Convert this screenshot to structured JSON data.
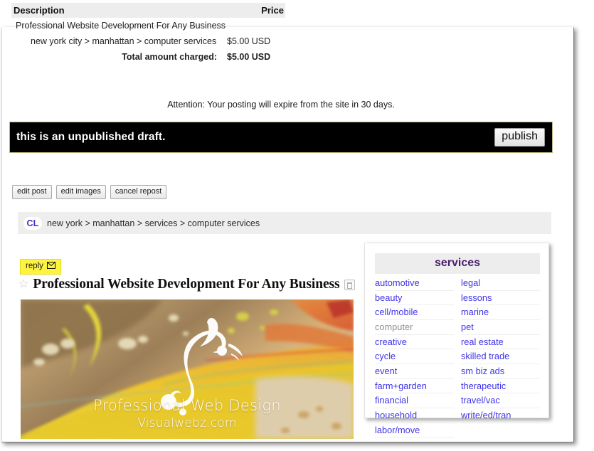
{
  "receipt": {
    "header": {
      "description_label": "Description",
      "price_label": "Price"
    },
    "rows": [
      {
        "description": "Professional Website Development For Any Business",
        "price": ""
      },
      {
        "description": "new york city > manhattan > computer services",
        "price": "$5.00 USD"
      }
    ],
    "total": {
      "label": "Total amount charged:",
      "amount": "$5.00 USD"
    }
  },
  "attention": {
    "text": "Attention: Your posting will expire from the site in 30 days."
  },
  "draft_banner": {
    "message": "this is an unpublished draft.",
    "publish_label": "publish",
    "background_color": "#000000",
    "border_color": "#b9b97a"
  },
  "edit_buttons": [
    {
      "label": "edit post"
    },
    {
      "label": "edit images"
    },
    {
      "label": "cancel repost"
    }
  ],
  "breadcrumb": {
    "logo_text": "CL",
    "trail": "new york > manhattan > services > computer services"
  },
  "posting": {
    "reply_label": "reply",
    "reply_icon": "envelope-icon",
    "favorite_icon": "star-icon",
    "delete_icon": "trash-icon",
    "title": "Professional Website Development For Any Business",
    "image": {
      "caption_line1": "Professional Web Design",
      "caption_line2": "Visualwebz.com"
    }
  },
  "services_panel": {
    "header": "services",
    "header_color": "#4b1f6e",
    "link_color": "#3f34e8",
    "visited_color": "#8e8e98",
    "column_left": [
      {
        "label": "automotive",
        "state": "link"
      },
      {
        "label": "beauty",
        "state": "link"
      },
      {
        "label": "cell/mobile",
        "state": "link"
      },
      {
        "label": "computer",
        "state": "visited"
      },
      {
        "label": "creative",
        "state": "link"
      },
      {
        "label": "cycle",
        "state": "link"
      },
      {
        "label": "event",
        "state": "link"
      },
      {
        "label": "farm+garden",
        "state": "link"
      },
      {
        "label": "financial",
        "state": "link"
      },
      {
        "label": "household",
        "state": "link"
      },
      {
        "label": "labor/move",
        "state": "link"
      }
    ],
    "column_right": [
      {
        "label": "legal",
        "state": "link"
      },
      {
        "label": "lessons",
        "state": "link"
      },
      {
        "label": "marine",
        "state": "link"
      },
      {
        "label": "pet",
        "state": "link"
      },
      {
        "label": "real estate",
        "state": "link"
      },
      {
        "label": "skilled trade",
        "state": "link"
      },
      {
        "label": "sm biz ads",
        "state": "link"
      },
      {
        "label": "therapeutic",
        "state": "link"
      },
      {
        "label": "travel/vac",
        "state": "link"
      },
      {
        "label": "write/ed/tran",
        "state": "link"
      }
    ]
  }
}
